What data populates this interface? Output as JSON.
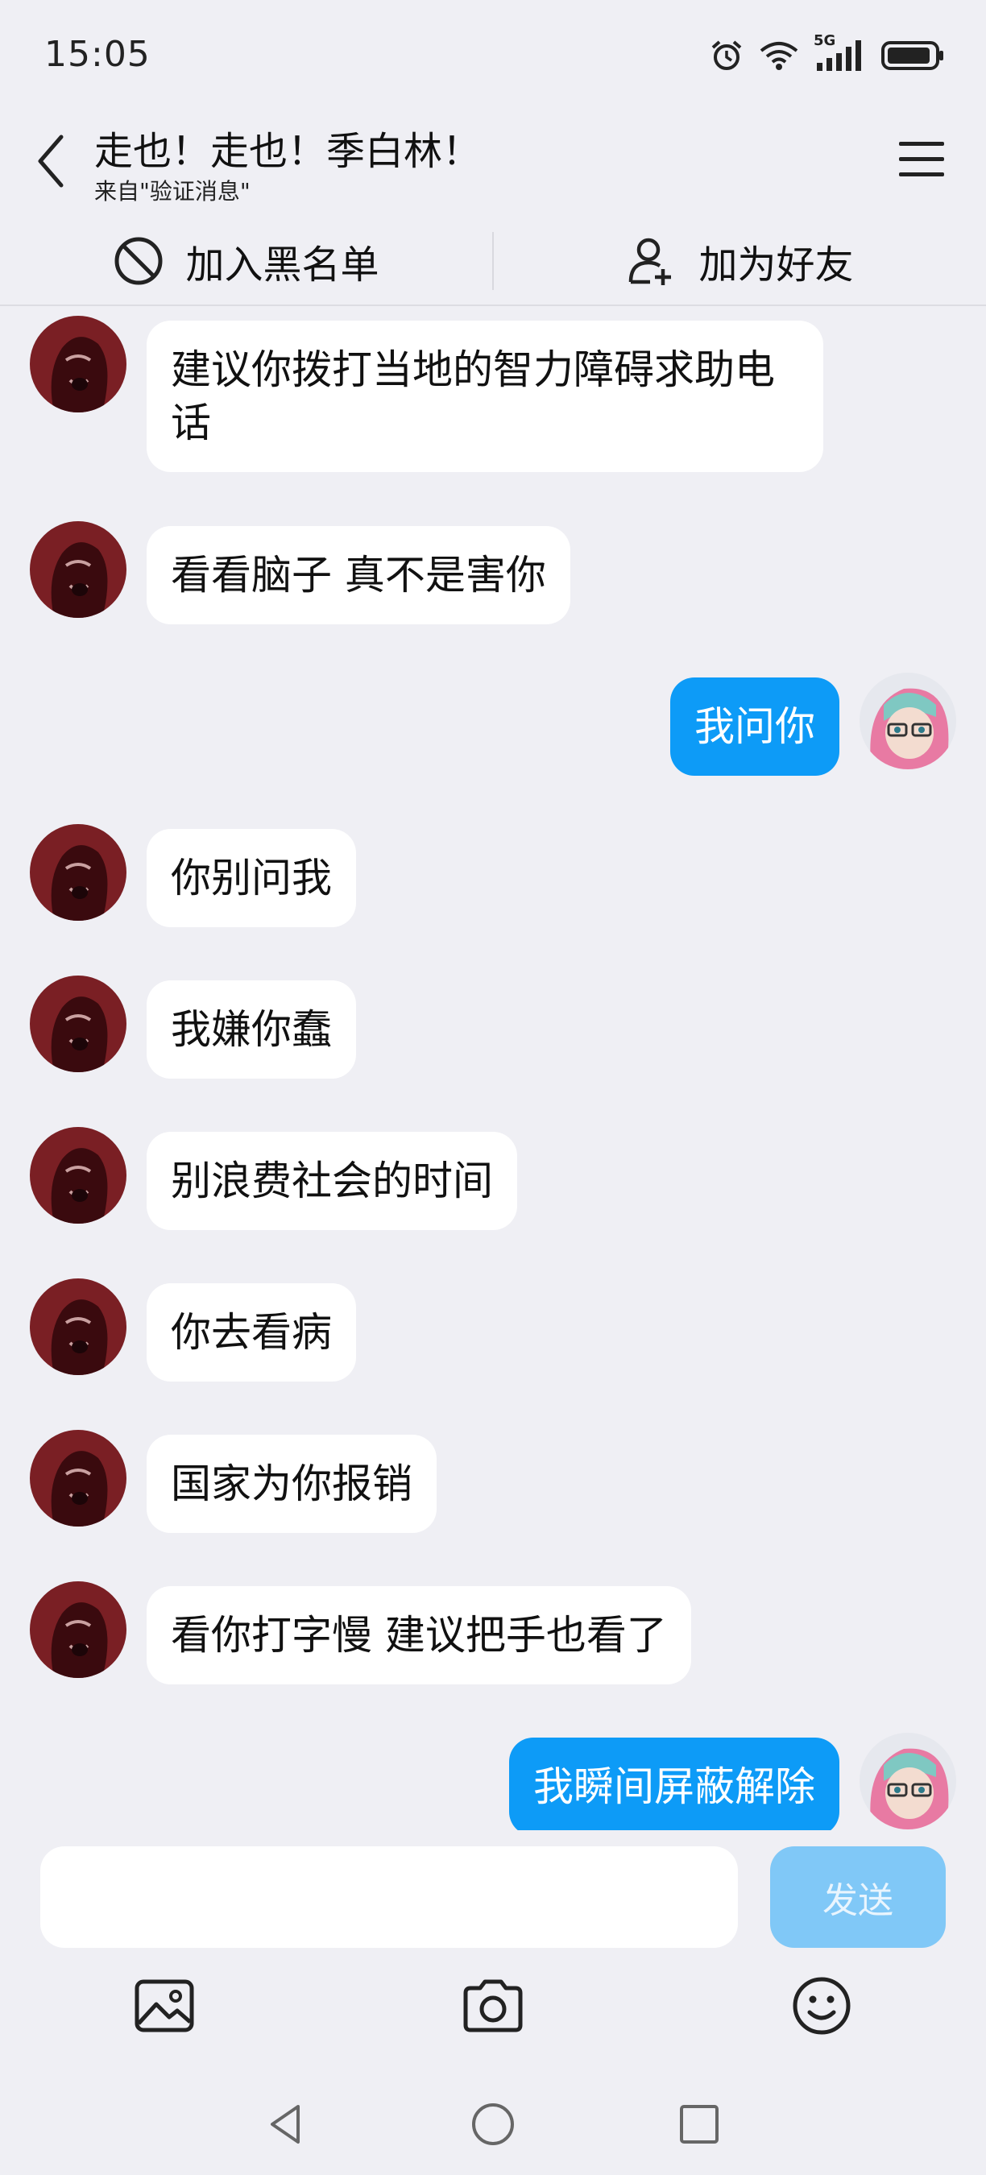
{
  "status_bar": {
    "time": "15:05",
    "network_label": "5G",
    "icons": [
      "alarm-icon",
      "wifi-icon",
      "signal-icon",
      "battery-icon"
    ]
  },
  "header": {
    "title": "走也！走也！季白林！",
    "subtitle": "来自\"验证消息\"",
    "back_icon": "chevron-left-icon",
    "menu_icon": "hamburger-menu-icon"
  },
  "actions": {
    "blacklist_label": "加入黑名单",
    "add_friend_label": "加为好友"
  },
  "messages": [
    {
      "side": "left",
      "text": "建议你拨打当地的智力障碍求助电话"
    },
    {
      "side": "left",
      "text": "看看脑子 真不是害你"
    },
    {
      "side": "right",
      "text": "我问你"
    },
    {
      "side": "left",
      "text": "你别问我"
    },
    {
      "side": "left",
      "text": "我嫌你蠢"
    },
    {
      "side": "left",
      "text": "别浪费社会的时间"
    },
    {
      "side": "left",
      "text": "你去看病"
    },
    {
      "side": "left",
      "text": "国家为你报销"
    },
    {
      "side": "left",
      "text": "看你打字慢 建议把手也看了"
    },
    {
      "side": "right",
      "text": "我瞬间屏蔽解除"
    }
  ],
  "input": {
    "value": "",
    "send_label": "发送"
  },
  "colors": {
    "background": "#efeff4",
    "outgoing_bubble": "#0d9bf7",
    "incoming_bubble": "#ffffff",
    "send_button": "#80c8f7"
  }
}
